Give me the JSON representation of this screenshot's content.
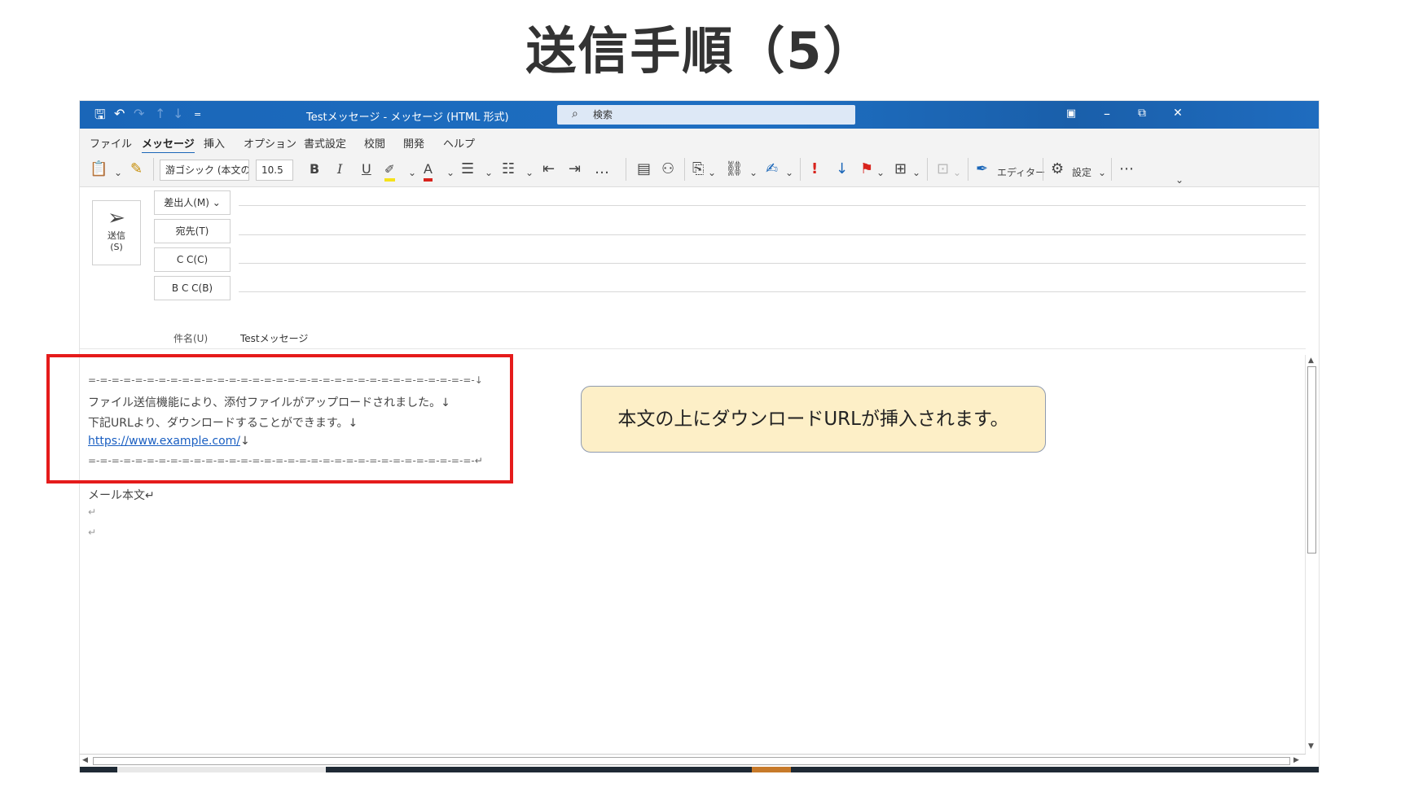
{
  "slide": {
    "title": "送信手順（5）"
  },
  "titlebar": {
    "window_title": "Testメッセージ  -  メッセージ (HTML 形式)",
    "search_placeholder": "検索",
    "quick_access_more": "=",
    "minimize": "–",
    "restore": "⧉",
    "close": "✕"
  },
  "menu": {
    "tabs": [
      "ファイル",
      "メッセージ",
      "挿入",
      "オプション",
      "書式設定",
      "校閲",
      "開発",
      "ヘルプ"
    ],
    "active_tab": "メッセージ"
  },
  "ribbon": {
    "font_name": "游ゴシック (本文の",
    "font_size": "10.5",
    "bold": "B",
    "italic": "I",
    "underline": "U",
    "font_color": "A",
    "more": "…",
    "importance_high": "!",
    "importance_low": "↓",
    "editor_label": "エディター",
    "settings_label": "設定",
    "overflow": "⋯"
  },
  "header": {
    "send_label_line1": "送信",
    "send_label_line2": "(S)",
    "from_button": "差出人(M) ⌄",
    "to_button": "宛先(T)",
    "cc_button": "C C(C)",
    "bcc_button": "B C C(B)",
    "subject_label": "件名(U)",
    "subject_value": "Testメッセージ"
  },
  "body": {
    "separator_top": "=-=-=-=-=-=-=-=-=-=-=-=-=-=-=-=-=-=-=-=-=-=-=-=-=-=-=-=-=-=-=-=-=-↓",
    "line1": "ファイル送信機能により、添付ファイルがアップロードされました。↓",
    "line2": "下記URLより、ダウンロードすることができます。↓",
    "link": "https://www.example.com/",
    "link_mark": "↓",
    "separator_bottom": "=-=-=-=-=-=-=-=-=-=-=-=-=-=-=-=-=-=-=-=-=-=-=-=-=-=-=-=-=-=-=-=-=-↵",
    "mail_body": "メール本文↵",
    "empty1": "↵",
    "empty2": "↵"
  },
  "callout": {
    "text": "本文の上にダウンロードURLが挿入されます。"
  },
  "colors": {
    "titlebar": "#1a66b8",
    "highlight_box": "#e51b1b",
    "callout_bg": "#fdefc7",
    "link": "#1a5fc2"
  },
  "icons": [
    "save-icon",
    "undo-icon",
    "redo-icon",
    "up-icon",
    "down-icon",
    "search-icon",
    "paste-icon",
    "format-painter-icon",
    "highlighter-icon",
    "bullets-icon",
    "numbering-icon",
    "outdent-icon",
    "indent-icon",
    "address-book-icon",
    "check-names-icon",
    "attach-icon",
    "link-icon",
    "signature-icon",
    "flag-icon",
    "tags-icon",
    "editor-icon",
    "settings-icon",
    "send-icon"
  ]
}
